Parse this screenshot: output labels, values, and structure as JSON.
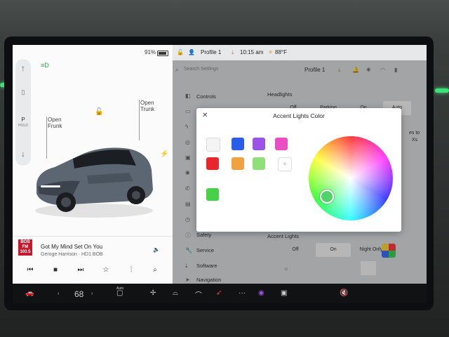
{
  "status": {
    "battery": "91%",
    "battery_level": 0.91,
    "profile": "Profile 1",
    "time": "10:15 am",
    "temp": "88°F"
  },
  "gear": {
    "p": "P",
    "hold": "HOLD"
  },
  "car": {
    "frunk_open": "Open",
    "frunk": "Frunk",
    "trunk_open": "Open",
    "trunk": "Trunk"
  },
  "media": {
    "station_lines": [
      "BOB",
      "FM",
      "103.5"
    ],
    "song": "Got My Mind Set On You",
    "artist": "Geroge Harrison · HD1 BOB"
  },
  "settings": {
    "search_placeholder": "Search Settings",
    "profile": "Profile 1",
    "nav": [
      "Controls",
      "Safety",
      "Service",
      "Software",
      "Navigation"
    ],
    "headlights_label": "Headlights",
    "headlights_options": [
      "Off",
      "Parking",
      "On",
      "Auto"
    ],
    "side_note": "es to",
    "side_note2": "Xs",
    "accent_label": "Accent Lights",
    "accent_options": [
      "Off",
      "On",
      "Night Only"
    ]
  },
  "modal": {
    "title": "Accent Lights Color",
    "swatches": [
      "#f4f4f4",
      "#2a5de8",
      "#9b52e6",
      "#e94ec4",
      "#e8262e",
      "#f2a140",
      "#8fe07a",
      "#48d048"
    ],
    "add_symbol": "+",
    "knob_color": "#4fd36a"
  },
  "dock": {
    "temp": "68",
    "auto": "Auto",
    "fan": "OFF"
  }
}
